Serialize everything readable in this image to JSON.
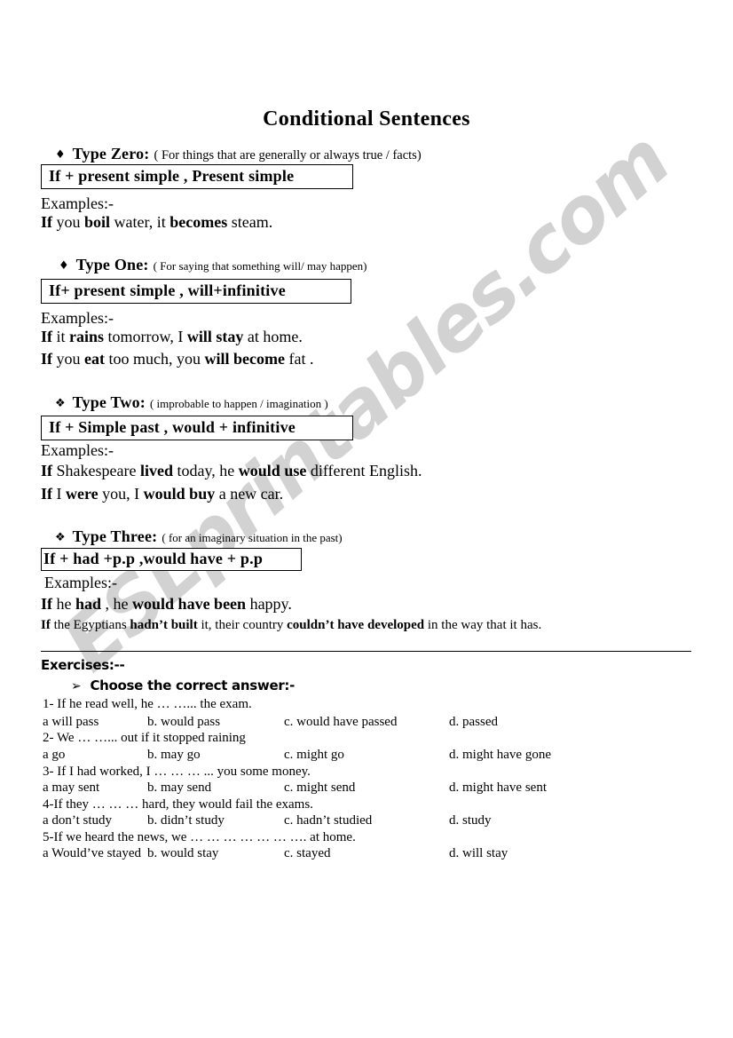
{
  "document": {
    "title": "Conditional Sentences",
    "watermark": "ESLprintables.com"
  },
  "types": [
    {
      "bullet": "diamond-solid-bullet",
      "bullet_glyph": "♦",
      "name": "Type Zero:",
      "description": "( For things that are generally or always true / facts)",
      "formula": "If  + present simple ,  Present simple",
      "examples_label": "Examples:-",
      "examples": [
        {
          "parts": [
            {
              "text": "If ",
              "bold": true
            },
            {
              "text": "you ",
              "bold": false
            },
            {
              "text": "boil",
              "bold": true
            },
            {
              "text": " water, it ",
              "bold": false
            },
            {
              "text": "becomes",
              "bold": true
            },
            {
              "text": " steam.",
              "bold": false
            }
          ]
        }
      ]
    },
    {
      "bullet": "diamond-solid-bullet",
      "bullet_glyph": "♦",
      "name": "Type One:",
      "description": "(  For saying that something will/ may happen)",
      "formula": "If+ present simple ,  will+infinitive",
      "examples_label": "Examples:-",
      "examples": [
        {
          "parts": [
            {
              "text": "If ",
              "bold": true
            },
            {
              "text": "it ",
              "bold": false
            },
            {
              "text": "rains",
              "bold": true
            },
            {
              "text": " tomorrow, I ",
              "bold": false
            },
            {
              "text": "will stay",
              "bold": true
            },
            {
              "text": " at home.",
              "bold": false
            }
          ]
        },
        {
          "parts": [
            {
              "text": "If ",
              "bold": true
            },
            {
              "text": "you ",
              "bold": false
            },
            {
              "text": "eat",
              "bold": true
            },
            {
              "text": " too much, you ",
              "bold": false
            },
            {
              "text": "will become",
              "bold": true
            },
            {
              "text": " fat .",
              "bold": false
            }
          ]
        }
      ]
    },
    {
      "bullet": "diamond-flower-bullet",
      "bullet_glyph": "❖",
      "name": "Type Two:",
      "description": "( improbable to happen / imagination    )",
      "formula": "If +  Simple past , would + infinitive",
      "examples_label": "Examples:-",
      "examples": [
        {
          "parts": [
            {
              "text": "If ",
              "bold": true
            },
            {
              "text": "Shakespeare ",
              "bold": false
            },
            {
              "text": "lived",
              "bold": true
            },
            {
              "text": " today, he ",
              "bold": false
            },
            {
              "text": "would use",
              "bold": true
            },
            {
              "text": " different English.",
              "bold": false
            }
          ]
        },
        {
          "parts": [
            {
              "text": "If ",
              "bold": true
            },
            {
              "text": "I ",
              "bold": false
            },
            {
              "text": "were",
              "bold": true
            },
            {
              "text": " you, I ",
              "bold": false
            },
            {
              "text": "would buy",
              "bold": true
            },
            {
              "text": " a new car.",
              "bold": false
            }
          ]
        }
      ]
    },
    {
      "bullet": "diamond-flower-bullet",
      "bullet_glyph": "❖",
      "name": "Type Three:",
      "description": "(  for  an imaginary situation in the past)",
      "formula": "If + had +p.p ,would have + p.p",
      "examples_label": "Examples:-",
      "examples": [
        {
          "parts": [
            {
              "text": "If ",
              "bold": true
            },
            {
              "text": "he ",
              "bold": false
            },
            {
              "text": "had",
              "bold": true
            },
            {
              "text": " , he ",
              "bold": false
            },
            {
              "text": "would have been",
              "bold": true
            },
            {
              "text": " happy.",
              "bold": false
            }
          ]
        },
        {
          "parts": [
            {
              "text": "If ",
              "bold": true
            },
            {
              "text": "the Egyptians ",
              "bold": false
            },
            {
              "text": "hadn’t built",
              "bold": true
            },
            {
              "text": " it, their country ",
              "bold": false
            },
            {
              "text": "couldn’t have developed",
              "bold": true
            },
            {
              "text": " in the way that it has.",
              "bold": false
            }
          ]
        }
      ]
    }
  ],
  "exercises": {
    "heading": "Exercises:--",
    "instruction": "Choose the correct answer:-",
    "instruction_bullet_glyph": "➢",
    "questions": [
      {
        "number": "1-",
        "text": "1- If he read well, he … …... the exam.",
        "options": [
          "a  will pass",
          "b. would pass",
          "c.  would have passed",
          "d. passed"
        ]
      },
      {
        "number": "2-",
        "text": "2- We … …... out if it stopped raining",
        "options": [
          "a  go",
          "b. may go",
          "c. might go",
          "d. might have gone"
        ]
      },
      {
        "number": "3-",
        "text": "3- If I had worked, I … … … ... you some money.",
        "options": [
          "a  may sent",
          "b. may send",
          "c. might send",
          "d. might have sent"
        ]
      },
      {
        "number": "4-",
        "text": "4-If they … … … hard, they would fail the exams.",
        "options": [
          "a  don’t study",
          "b. didn’t study",
          "c. hadn’t studied",
          "d. study"
        ]
      },
      {
        "number": "5-",
        "text": "5-If we heard the news, we … … … … … … …. at home.",
        "options": [
          "a  Would’ve stayed",
          "b.  would stay",
          "c. stayed",
          "d. will stay"
        ]
      }
    ]
  }
}
